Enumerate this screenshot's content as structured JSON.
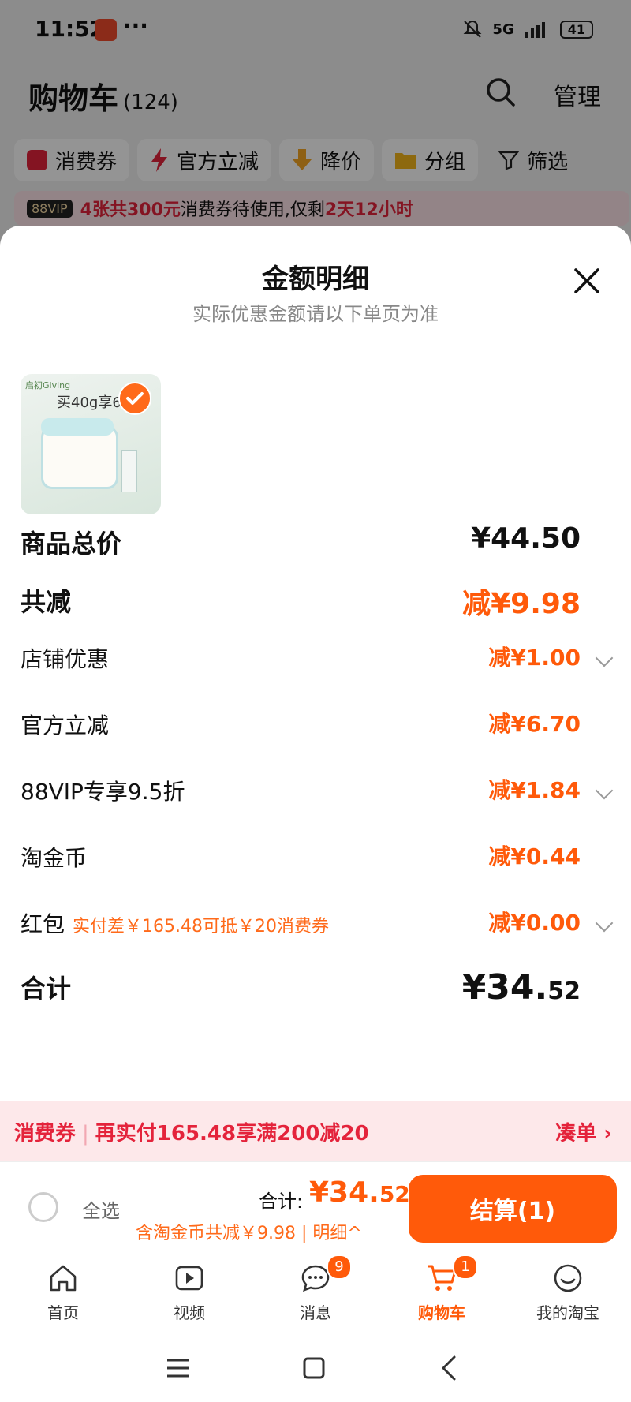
{
  "status": {
    "time": "11:52",
    "dots": "···",
    "network": "5G",
    "battery": "41"
  },
  "header": {
    "title": "购物车",
    "count": "(124)",
    "manage": "管理"
  },
  "chips": [
    {
      "label": "消费券",
      "icon": "coupon-icon"
    },
    {
      "label": "官方立减",
      "icon": "lightning-icon"
    },
    {
      "label": "降价",
      "icon": "price-down-icon"
    },
    {
      "label": "分组",
      "icon": "folder-icon"
    },
    {
      "label": "筛选",
      "icon": "filter-icon"
    }
  ],
  "vip_banner": {
    "badge": "88VIP",
    "p1": "4张共300元",
    "p2": "消费券待使用,仅剩",
    "p3": "2天12小时"
  },
  "sheet": {
    "title": "金额明细",
    "subtitle": "实际优惠金额请以下单页为准",
    "product": {
      "text": "买40g享60",
      "brand": "启初Giving"
    }
  },
  "rows": {
    "total_price": {
      "label": "商品总价",
      "value": "¥44.50"
    },
    "total_discount": {
      "label": "共减",
      "value": "减¥9.98"
    },
    "shop": {
      "label": "店铺优惠",
      "value": "减¥1.00"
    },
    "official": {
      "label": "官方立减",
      "value": "减¥6.70"
    },
    "vip": {
      "label": "88VIP专享9.5折",
      "value": "减¥1.84"
    },
    "coin": {
      "label": "淘金币",
      "value": "减¥0.44"
    },
    "redpacket": {
      "label": "红包",
      "note": "实付差￥165.48可抵￥20消费券",
      "value": "减¥0.00"
    },
    "sum": {
      "label": "合计",
      "value_main": "¥34.",
      "value_cents": "52"
    }
  },
  "coupon_bar": {
    "left1": "消费券",
    "left2": "再实付165.48享满200减20",
    "right": "凑单 ›"
  },
  "checkout": {
    "select_all": "全选",
    "sum_label": "合计:",
    "sum_main": "¥34.",
    "sum_cents": "52",
    "sub": "含淘金币共减￥9.98 | 明细^",
    "button": "结算(1)"
  },
  "tabs": [
    {
      "label": "首页",
      "icon": "home-icon"
    },
    {
      "label": "视频",
      "icon": "video-icon"
    },
    {
      "label": "消息",
      "icon": "message-icon",
      "badge": "9"
    },
    {
      "label": "购物车",
      "icon": "cart-icon",
      "badge": "1"
    },
    {
      "label": "我的淘宝",
      "icon": "profile-icon"
    }
  ],
  "colors": {
    "accent": "#ff5a0a",
    "red": "#e4233b"
  }
}
